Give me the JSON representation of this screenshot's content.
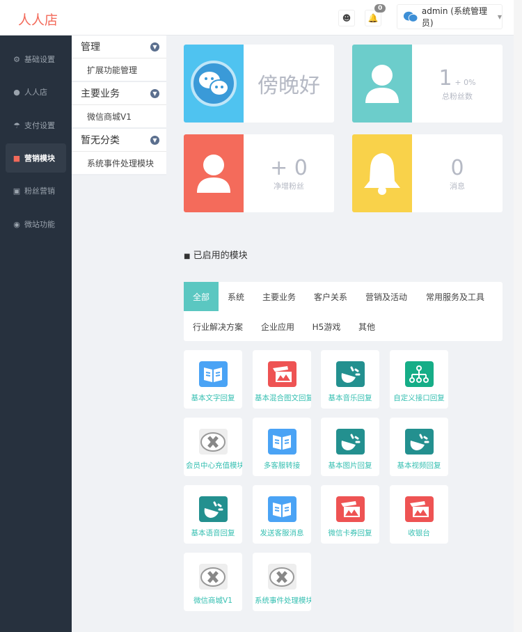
{
  "header": {
    "logo": "人人店",
    "notification_count": "0",
    "user": "admin (系统管理员)"
  },
  "sidebar": {
    "items": [
      {
        "label": "基础设置",
        "icon": "gear-icon"
      },
      {
        "label": "人人店",
        "icon": "users-icon"
      },
      {
        "label": "支付设置",
        "icon": "umbrella-icon"
      },
      {
        "label": "营销模块",
        "icon": "cubes-icon",
        "active": true
      },
      {
        "label": "粉丝营销",
        "icon": "gift-icon"
      },
      {
        "label": "微站功能",
        "icon": "lifebuoy-icon"
      }
    ]
  },
  "submenu": {
    "groups": [
      {
        "title": "管理",
        "items": [
          "扩展功能管理"
        ]
      },
      {
        "title": "主要业务",
        "items": [
          "微信商城V1"
        ]
      },
      {
        "title": "暂无分类",
        "items": [
          "系统事件处理模块"
        ]
      }
    ]
  },
  "stats": {
    "greeting": "傍晚好",
    "fans_total": "1",
    "fans_change": "+ 0%",
    "fans_total_label": "总粉丝数",
    "net_fans": "+ 0",
    "net_fans_label": "净增粉丝",
    "messages": "0",
    "messages_label": "消息"
  },
  "modules_title": "已启用的模块",
  "tabs": [
    "全部",
    "系统",
    "主要业务",
    "客户关系",
    "营销及活动",
    "常用服务及工具",
    "行业解决方案",
    "企业应用",
    "H5游戏",
    "其他"
  ],
  "modules": [
    {
      "label": "基本文字回复",
      "icon": "book"
    },
    {
      "label": "基本混合图文回复",
      "icon": "image"
    },
    {
      "label": "基本音乐回复",
      "icon": "speaker"
    },
    {
      "label": "自定义接口回复",
      "icon": "tree"
    },
    {
      "label": "会员中心充值模块",
      "icon": "x"
    },
    {
      "label": "多客服转接",
      "icon": "book"
    },
    {
      "label": "基本图片回复",
      "icon": "speaker"
    },
    {
      "label": "基本视频回复",
      "icon": "speaker"
    },
    {
      "label": "基本语音回复",
      "icon": "speaker"
    },
    {
      "label": "发送客服消息",
      "icon": "book"
    },
    {
      "label": "微信卡券回复",
      "icon": "image"
    },
    {
      "label": "收银台",
      "icon": "image"
    },
    {
      "label": "微信商城V1",
      "icon": "x"
    },
    {
      "label": "系统事件处理模块",
      "icon": "x"
    }
  ]
}
